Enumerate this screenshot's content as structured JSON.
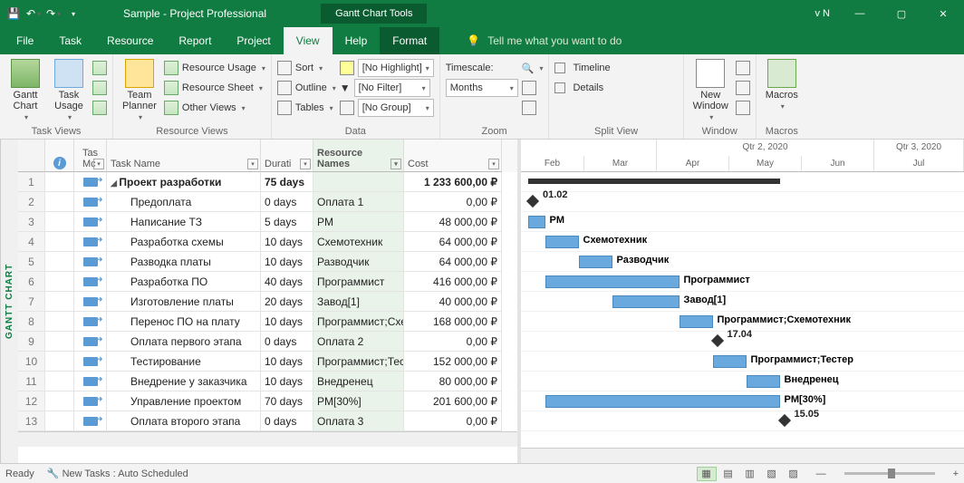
{
  "titlebar": {
    "title": "Sample  -  Project Professional",
    "tools_tab": "Gantt Chart Tools",
    "version": "v N"
  },
  "tabs": {
    "file": "File",
    "task": "Task",
    "resource": "Resource",
    "report": "Report",
    "project": "Project",
    "view": "View",
    "help": "Help",
    "format": "Format",
    "tell_me": "Tell me what you want to do"
  },
  "ribbon": {
    "task_views": {
      "label": "Task Views",
      "gantt_chart": "Gantt\nChart",
      "task_usage": "Task\nUsage"
    },
    "resource_views": {
      "label": "Resource Views",
      "team_planner": "Team\nPlanner",
      "resource_usage": "Resource Usage",
      "resource_sheet": "Resource Sheet",
      "other_views": "Other Views"
    },
    "data": {
      "label": "Data",
      "sort": "Sort",
      "outline": "Outline",
      "tables": "Tables",
      "highlight": "[No Highlight]",
      "filter": "[No Filter]",
      "group": "[No Group]"
    },
    "zoom": {
      "label": "Zoom",
      "timescale": "Timescale:",
      "months": "Months"
    },
    "split_view": {
      "label": "Split View",
      "timeline": "Timeline",
      "details": "Details"
    },
    "window": {
      "label": "Window",
      "new_window": "New\nWindow"
    },
    "macros": {
      "label": "Macros",
      "macros": "Macros"
    }
  },
  "columns": {
    "info": "",
    "task_mode": "Tas\nMc",
    "task_name": "Task Name",
    "duration": "Durati",
    "resource_names": "Resource\nNames",
    "cost": "Cost"
  },
  "rows": [
    {
      "n": "1",
      "mode": true,
      "name": "Проект разработки",
      "root": true,
      "dur": "75 days",
      "res": "",
      "cost": "1 233 600,00 ₽"
    },
    {
      "n": "2",
      "mode": true,
      "name": "Предоплата",
      "dur": "0 days",
      "res": "Оплата 1",
      "cost": "0,00 ₽"
    },
    {
      "n": "3",
      "mode": true,
      "name": "Написание ТЗ",
      "dur": "5 days",
      "res": "PM",
      "cost": "48 000,00 ₽"
    },
    {
      "n": "4",
      "mode": true,
      "name": "Разработка схемы",
      "dur": "10 days",
      "res": "Схемотехник",
      "cost": "64 000,00 ₽"
    },
    {
      "n": "5",
      "mode": true,
      "name": "Разводка платы",
      "dur": "10 days",
      "res": "Разводчик",
      "cost": "64 000,00 ₽"
    },
    {
      "n": "6",
      "mode": true,
      "name": "Разработка ПО",
      "dur": "40 days",
      "res": "Программист",
      "cost": "416 000,00 ₽"
    },
    {
      "n": "7",
      "mode": true,
      "name": "Изготовление платы",
      "dur": "20 days",
      "res": "Завод[1]",
      "cost": "40 000,00 ₽"
    },
    {
      "n": "8",
      "mode": true,
      "name": "Перенос ПО на плату",
      "dur": "10 days",
      "res": "Программист;Схемотехник",
      "cost": "168 000,00 ₽"
    },
    {
      "n": "9",
      "mode": true,
      "name": "Оплата первого этапа",
      "dur": "0 days",
      "res": "Оплата 2",
      "cost": "0,00 ₽"
    },
    {
      "n": "10",
      "mode": true,
      "name": "Тестирование",
      "dur": "10 days",
      "res": "Программист;Тестер",
      "cost": "152 000,00 ₽"
    },
    {
      "n": "11",
      "mode": true,
      "name": "Внедрение у заказчика",
      "dur": "10 days",
      "res": "Внедренец",
      "cost": "80 000,00 ₽"
    },
    {
      "n": "12",
      "mode": true,
      "name": "Управление проектом",
      "dur": "70 days",
      "res": "PM[30%]",
      "cost": "201 600,00 ₽"
    },
    {
      "n": "13",
      "mode": true,
      "name": "Оплата второго этапа",
      "dur": "0 days",
      "res": "Оплата 3",
      "cost": "0,00 ₽"
    }
  ],
  "timescale": {
    "top": [
      "",
      "Qtr 2, 2020",
      "Qtr 3, 2020"
    ],
    "bottom": [
      "Feb",
      "Mar",
      "Apr",
      "May",
      "Jun",
      "Jul"
    ]
  },
  "gantt_labels": {
    "r2": "01.02",
    "r3": "PM",
    "r4": "Схемотехник",
    "r5": "Разводчик",
    "r6": "Программист",
    "r7": "Завод[1]",
    "r8": "Программист;Схемотехник",
    "r9": "17.04",
    "r10": "Программист;Тестер",
    "r11": "Внедренец",
    "r12": "PM[30%]",
    "r13": "15.05"
  },
  "sidelabel": "GANTT CHART",
  "status": {
    "ready": "Ready",
    "new_tasks": "New Tasks : Auto Scheduled"
  },
  "chart_data": {
    "type": "gantt",
    "title": "Проект разработки",
    "unit": "days",
    "tasks": [
      {
        "id": 1,
        "name": "Проект разработки",
        "type": "summary",
        "start": 0,
        "duration": 75,
        "cost": 1233600
      },
      {
        "id": 2,
        "name": "Предоплата",
        "type": "milestone",
        "start": 0,
        "label": "01.02",
        "resources": [
          "Оплата 1"
        ],
        "cost": 0
      },
      {
        "id": 3,
        "name": "Написание ТЗ",
        "type": "task",
        "start": 0,
        "duration": 5,
        "resources": [
          "PM"
        ],
        "cost": 48000
      },
      {
        "id": 4,
        "name": "Разработка схемы",
        "type": "task",
        "start": 5,
        "duration": 10,
        "resources": [
          "Схемотехник"
        ],
        "cost": 64000
      },
      {
        "id": 5,
        "name": "Разводка платы",
        "type": "task",
        "start": 15,
        "duration": 10,
        "resources": [
          "Разводчик"
        ],
        "cost": 64000
      },
      {
        "id": 6,
        "name": "Разработка ПО",
        "type": "task",
        "start": 5,
        "duration": 40,
        "resources": [
          "Программист"
        ],
        "cost": 416000
      },
      {
        "id": 7,
        "name": "Изготовление платы",
        "type": "task",
        "start": 25,
        "duration": 20,
        "resources": [
          "Завод[1]"
        ],
        "cost": 40000
      },
      {
        "id": 8,
        "name": "Перенос ПО на плату",
        "type": "task",
        "start": 45,
        "duration": 10,
        "resources": [
          "Программист",
          "Схемотехник"
        ],
        "cost": 168000
      },
      {
        "id": 9,
        "name": "Оплата первого этапа",
        "type": "milestone",
        "start": 55,
        "label": "17.04",
        "resources": [
          "Оплата 2"
        ],
        "cost": 0
      },
      {
        "id": 10,
        "name": "Тестирование",
        "type": "task",
        "start": 55,
        "duration": 10,
        "resources": [
          "Программист",
          "Тестер"
        ],
        "cost": 152000
      },
      {
        "id": 11,
        "name": "Внедрение у заказчика",
        "type": "task",
        "start": 65,
        "duration": 10,
        "resources": [
          "Внедренец"
        ],
        "cost": 80000
      },
      {
        "id": 12,
        "name": "Управление проектом",
        "type": "task",
        "start": 5,
        "duration": 70,
        "resources": [
          "PM[30%]"
        ],
        "cost": 201600
      },
      {
        "id": 13,
        "name": "Оплата второго этапа",
        "type": "milestone",
        "start": 75,
        "label": "15.05",
        "resources": [
          "Оплата 3"
        ],
        "cost": 0
      }
    ],
    "currency": "₽",
    "total_cost": 1233600,
    "timeline_months": [
      "Feb",
      "Mar",
      "Apr",
      "May",
      "Jun",
      "Jul"
    ],
    "quarters": [
      "Qtr 2, 2020",
      "Qtr 3, 2020"
    ]
  }
}
